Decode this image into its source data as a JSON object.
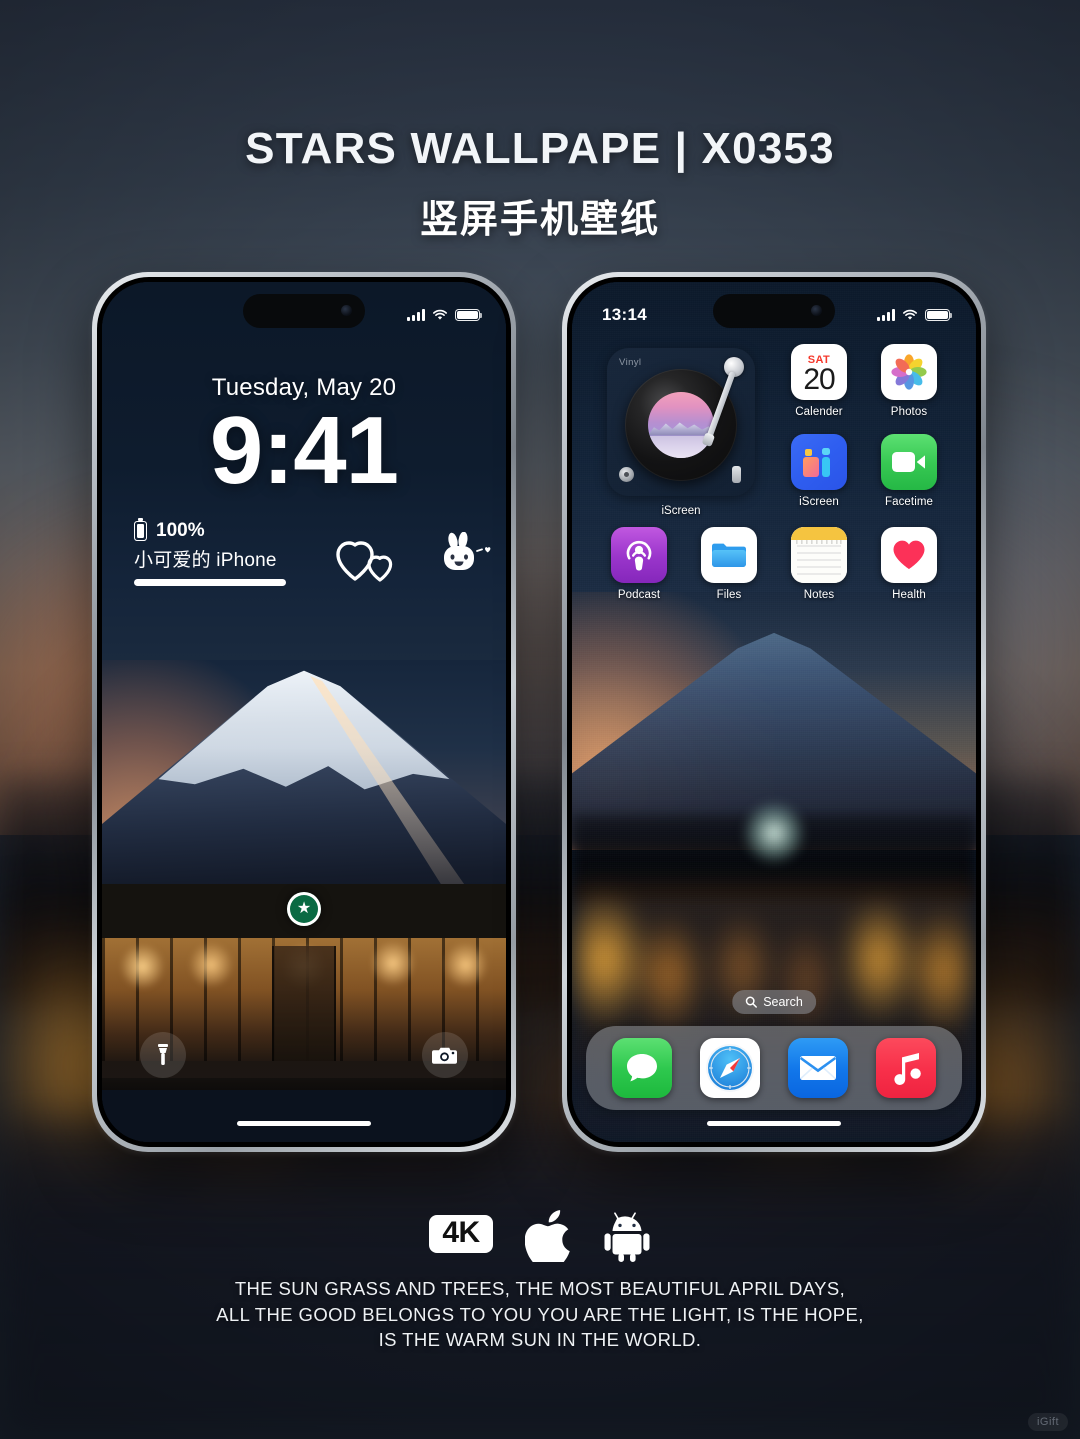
{
  "header": {
    "title_en": "STARS WALLPAPE | X0353",
    "title_cn": "竖屏手机壁纸"
  },
  "lock_screen": {
    "status": {
      "time": "",
      "signal_icon": "cellular-signal-icon",
      "wifi_icon": "wifi-icon",
      "battery_icon": "battery-icon"
    },
    "date": "Tuesday, May 20",
    "time": "9:41",
    "battery_widget": {
      "percent": "100%",
      "device_name": "小可爱的 iPhone"
    },
    "stickers": [
      {
        "name": "hearts-sticker"
      },
      {
        "name": "bunny-sticker"
      }
    ],
    "controls": [
      {
        "name": "flashlight-button",
        "icon": "flashlight-icon"
      },
      {
        "name": "camera-button",
        "icon": "camera-icon"
      }
    ],
    "wallpaper": {
      "subject": "Mount Fuji with Starbucks storefront at dusk"
    }
  },
  "home_screen": {
    "status": {
      "time": "13:14",
      "signal_icon": "cellular-signal-icon",
      "wifi_icon": "wifi-icon",
      "battery_icon": "battery-icon"
    },
    "widget": {
      "tag": "Vinyl",
      "label": "iScreen"
    },
    "apps": [
      {
        "label": "Calender",
        "icon": "calendar-icon",
        "dow": "SAT",
        "day": "20"
      },
      {
        "label": "Photos",
        "icon": "photos-icon"
      },
      {
        "label": "iScreen",
        "icon": "iscreen-icon"
      },
      {
        "label": "Facetime",
        "icon": "facetime-icon"
      },
      {
        "label": "Podcast",
        "icon": "podcast-icon"
      },
      {
        "label": "Files",
        "icon": "files-icon"
      },
      {
        "label": "Notes",
        "icon": "notes-icon"
      },
      {
        "label": "Health",
        "icon": "health-icon"
      }
    ],
    "search": {
      "label": "Search",
      "icon": "search-icon"
    },
    "dock": [
      {
        "label": "Messages",
        "icon": "messages-icon"
      },
      {
        "label": "Safari",
        "icon": "safari-icon"
      },
      {
        "label": "Mail",
        "icon": "mail-icon"
      },
      {
        "label": "Music",
        "icon": "music-icon"
      }
    ],
    "wallpaper": {
      "subject": "Blurred Mount Fuji at dusk with city lights"
    }
  },
  "badges": [
    {
      "name": "resolution-badge",
      "label": "4K"
    },
    {
      "name": "apple-badge",
      "icon": "apple-icon"
    },
    {
      "name": "android-badge",
      "icon": "android-icon"
    }
  ],
  "caption": {
    "line1": "THE SUN GRASS AND TREES, THE MOST BEAUTIFUL APRIL DAYS,",
    "line2": "ALL THE GOOD BELONGS TO YOU YOU ARE THE LIGHT, IS THE HOPE,",
    "line3": "IS THE WARM SUN IN THE WORLD."
  },
  "watermark": {
    "label": "iGift"
  },
  "colors": {
    "accent_red": "#f5392c",
    "accent_green": "#2ec84e",
    "accent_blue": "#1277ea",
    "accent_pink": "#f8304a",
    "accent_purple": "#9b36cc",
    "background": "#1b2430"
  }
}
